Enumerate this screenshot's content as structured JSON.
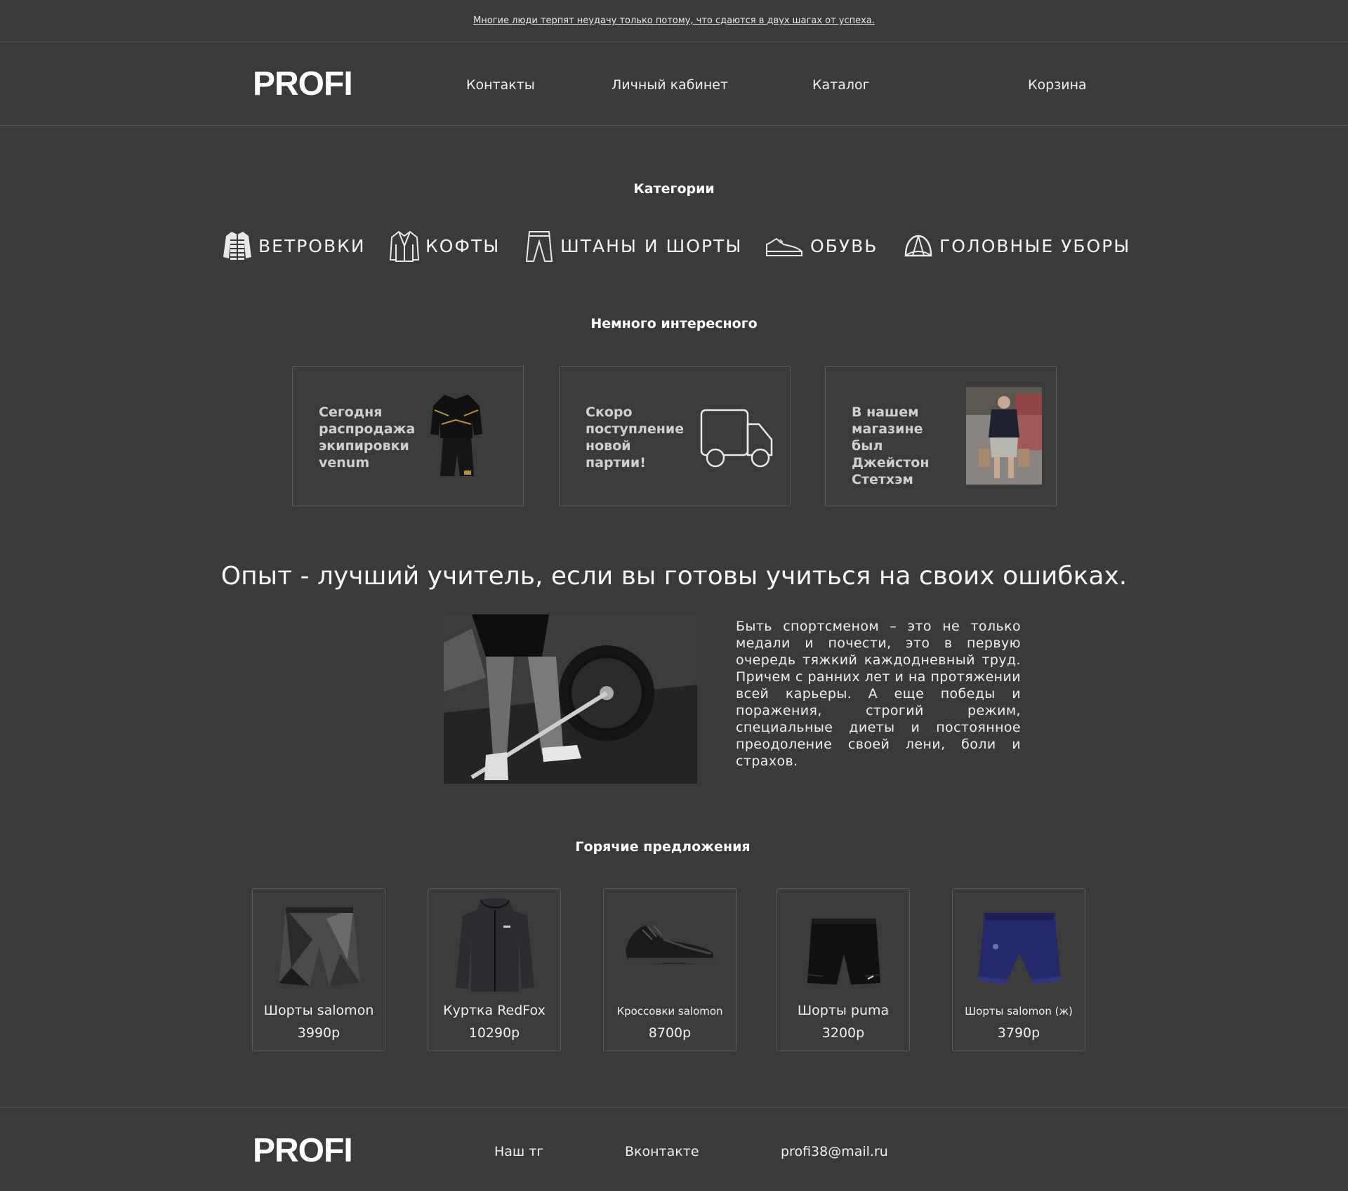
{
  "topbar": {
    "quote_link": "Многие люди терпят неудачу только потому, что сдаются в двух шагах от успеха."
  },
  "header": {
    "logo": "PROFI",
    "nav": [
      "Контакты",
      "Личный кабинет",
      "Каталог",
      "Корзина"
    ]
  },
  "categories": {
    "title": "Категории",
    "items": [
      {
        "label": "ВЕТРОВКИ",
        "icon": "jacket-icon"
      },
      {
        "label": "КОФТЫ",
        "icon": "sweater-icon"
      },
      {
        "label": "ШТАНЫ И ШОРТЫ",
        "icon": "pants-icon"
      },
      {
        "label": "ОБУВЬ",
        "icon": "sneaker-icon"
      },
      {
        "label": "ГОЛОВНЫЕ УБОРЫ",
        "icon": "cap-icon"
      }
    ]
  },
  "interesting": {
    "title": "Немного интересного",
    "cards": [
      {
        "text": "Сегодня распродажа экипировки venum",
        "image": "venum-suit-photo"
      },
      {
        "text": "Скоро поступление новой партии!",
        "image": "truck-icon"
      },
      {
        "text": "В нашем магазине был Джейстон Стетхэм",
        "image": "statham-photo"
      }
    ]
  },
  "motto": {
    "quote": "Опыт - лучший учитель, если вы готовы учиться на своих ошибках.",
    "paragraph": "Быть спортсменом – это не только медали и почести, это в первую очередь тяжкий каждодневный труд. Причем с ранних лет и на протяжении всей карьеры. А еще победы и поражения, строгий режим, специальные диеты и постоянное преодоление своей лени, боли и страхов."
  },
  "offers": {
    "title": "Горячие предложения",
    "products": [
      {
        "name": "Шорты salomon",
        "price": "3990р"
      },
      {
        "name": "Куртка RedFox",
        "price": "10290р"
      },
      {
        "name": "Кроссовки salomon",
        "price": "8700р"
      },
      {
        "name": "Шорты puma",
        "price": "3200р"
      },
      {
        "name": "Шорты salomon (ж)",
        "price": "3790р"
      }
    ]
  },
  "footer": {
    "logo": "PROFI",
    "links": [
      "Наш тг",
      "Вконтакте",
      "profi38@mail.ru"
    ]
  },
  "colors": {
    "background": "#3a3a3a",
    "text": "#f2f2f2",
    "border": "#555555"
  }
}
